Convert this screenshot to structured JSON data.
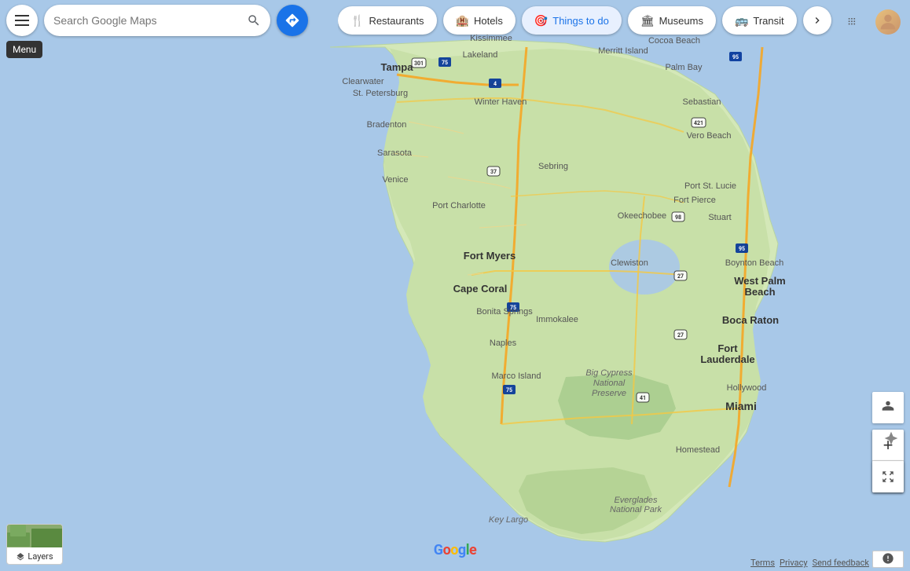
{
  "app": {
    "title": "Google Maps"
  },
  "search": {
    "placeholder": "Search Google Maps",
    "current_value": ""
  },
  "tooltip": {
    "menu_label": "Menu"
  },
  "chips": [
    {
      "id": "restaurants",
      "label": "Restaurants",
      "icon": "🍴",
      "active": false
    },
    {
      "id": "hotels",
      "label": "Hotels",
      "icon": "🏨",
      "active": false
    },
    {
      "id": "things-to-do",
      "label": "Things to do",
      "icon": "🎯",
      "active": true
    },
    {
      "id": "museums",
      "label": "Museums",
      "icon": "🏛",
      "active": false
    },
    {
      "id": "transit",
      "label": "Transit",
      "icon": "🚌",
      "active": false
    }
  ],
  "layers_label": "Layers",
  "zoom_in_label": "+",
  "zoom_out_label": "−",
  "map_locations": [
    "Tampa",
    "Clearwater",
    "St. Petersburg",
    "Lakeland",
    "Bradenton",
    "Sarasota",
    "Venice",
    "Port Charlotte",
    "Fort Myers",
    "Cape Coral",
    "Bonita Springs",
    "Naples",
    "Marco Island",
    "Immokalee",
    "Big Cypress National Preserve",
    "Everglades National Park",
    "Key Largo",
    "Miami",
    "Hollywood",
    "Fort Lauderdale",
    "Boca Raton",
    "Boynton Beach",
    "West Palm Beach",
    "Stuart",
    "Fort Pierce",
    "Port St. Lucie",
    "Vero Beach",
    "Sebastian",
    "Okeechobee",
    "Clewiston",
    "Sebring",
    "Winter Haven",
    "Kissimmee",
    "Merritt Island",
    "Cocoa Beach",
    "Palm Bay",
    "Homestead"
  ],
  "colors": {
    "water": "#a8c8e8",
    "land": "#e8f4d4",
    "roads": "#f5c842",
    "highways": "#f5a623",
    "active_chip_bg": "#e8f0fe",
    "active_chip_text": "#1a73e8",
    "header_bg": "white",
    "directions_btn": "#1a73e8"
  },
  "icons": {
    "menu": "☰",
    "search": "🔍",
    "directions": "➤",
    "apps": "⠿",
    "layers": "◧",
    "street_view": "🧍",
    "zoom_in": "+",
    "zoom_out": "−",
    "expand": "⤢",
    "more_chips": "❯"
  }
}
